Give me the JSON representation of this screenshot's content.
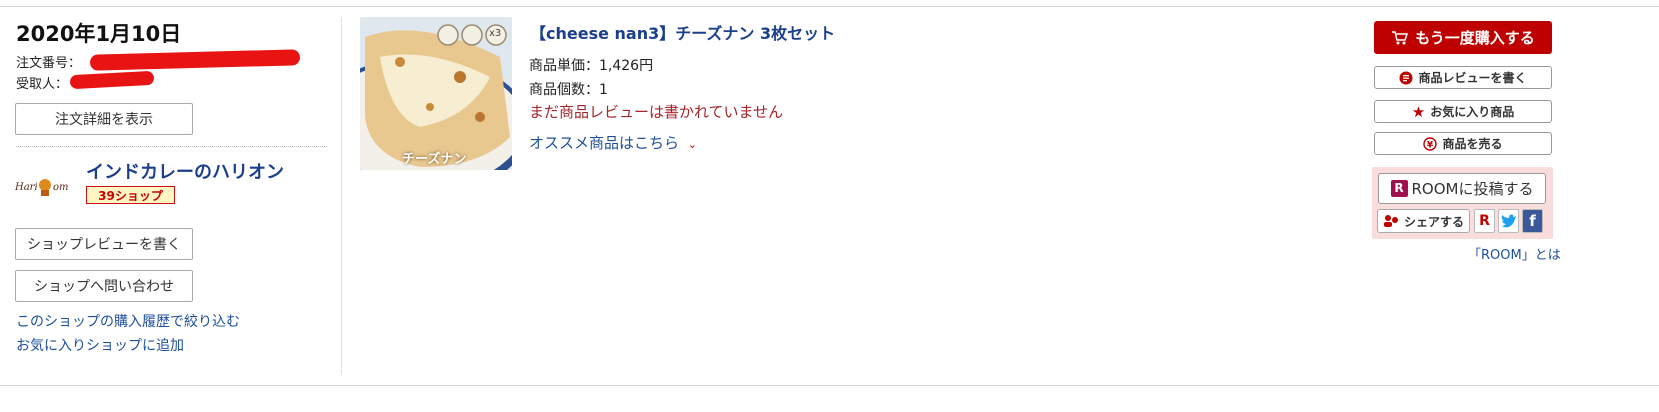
{
  "order": {
    "date": "2020年1月10日",
    "order_number_label": "注文番号：",
    "recipient_label": "受取人：",
    "details_button": "注文詳細を表示"
  },
  "shop": {
    "logo_text": "Hari om",
    "name": "インドカレーのハリオン",
    "badge": "39ショップ",
    "review_button": "ショップレビューを書く",
    "contact_button": "ショップへ問い合わせ",
    "filter_link": "このショップの購入履歴で絞り込む",
    "favorite_link": "お気に入りショップに追加"
  },
  "item": {
    "image_caption": "チーズナン",
    "image_badge": "x3",
    "title": "【cheese nan3】チーズナン 3枚セット",
    "unit_price": "商品単価：1,426円",
    "quantity": "商品個数：1",
    "review_status": "まだ商品レビューは書かれていません",
    "recommend_link": "オススメ商品はこちら"
  },
  "actions": {
    "buy_again": "もう一度購入する",
    "write_review": "商品レビューを書く",
    "favorite_item": "お気に入り商品",
    "sell_item": "商品を売る",
    "room_post": "ROOMに投稿する",
    "share": "シェアする",
    "room_about": "「ROOM」とは"
  },
  "colors": {
    "buy_button": "#bf0000",
    "link": "#1e4f9c",
    "title": "#1b3f8c",
    "warning": "#a3262b",
    "room_panel": "#f9dcdc"
  }
}
